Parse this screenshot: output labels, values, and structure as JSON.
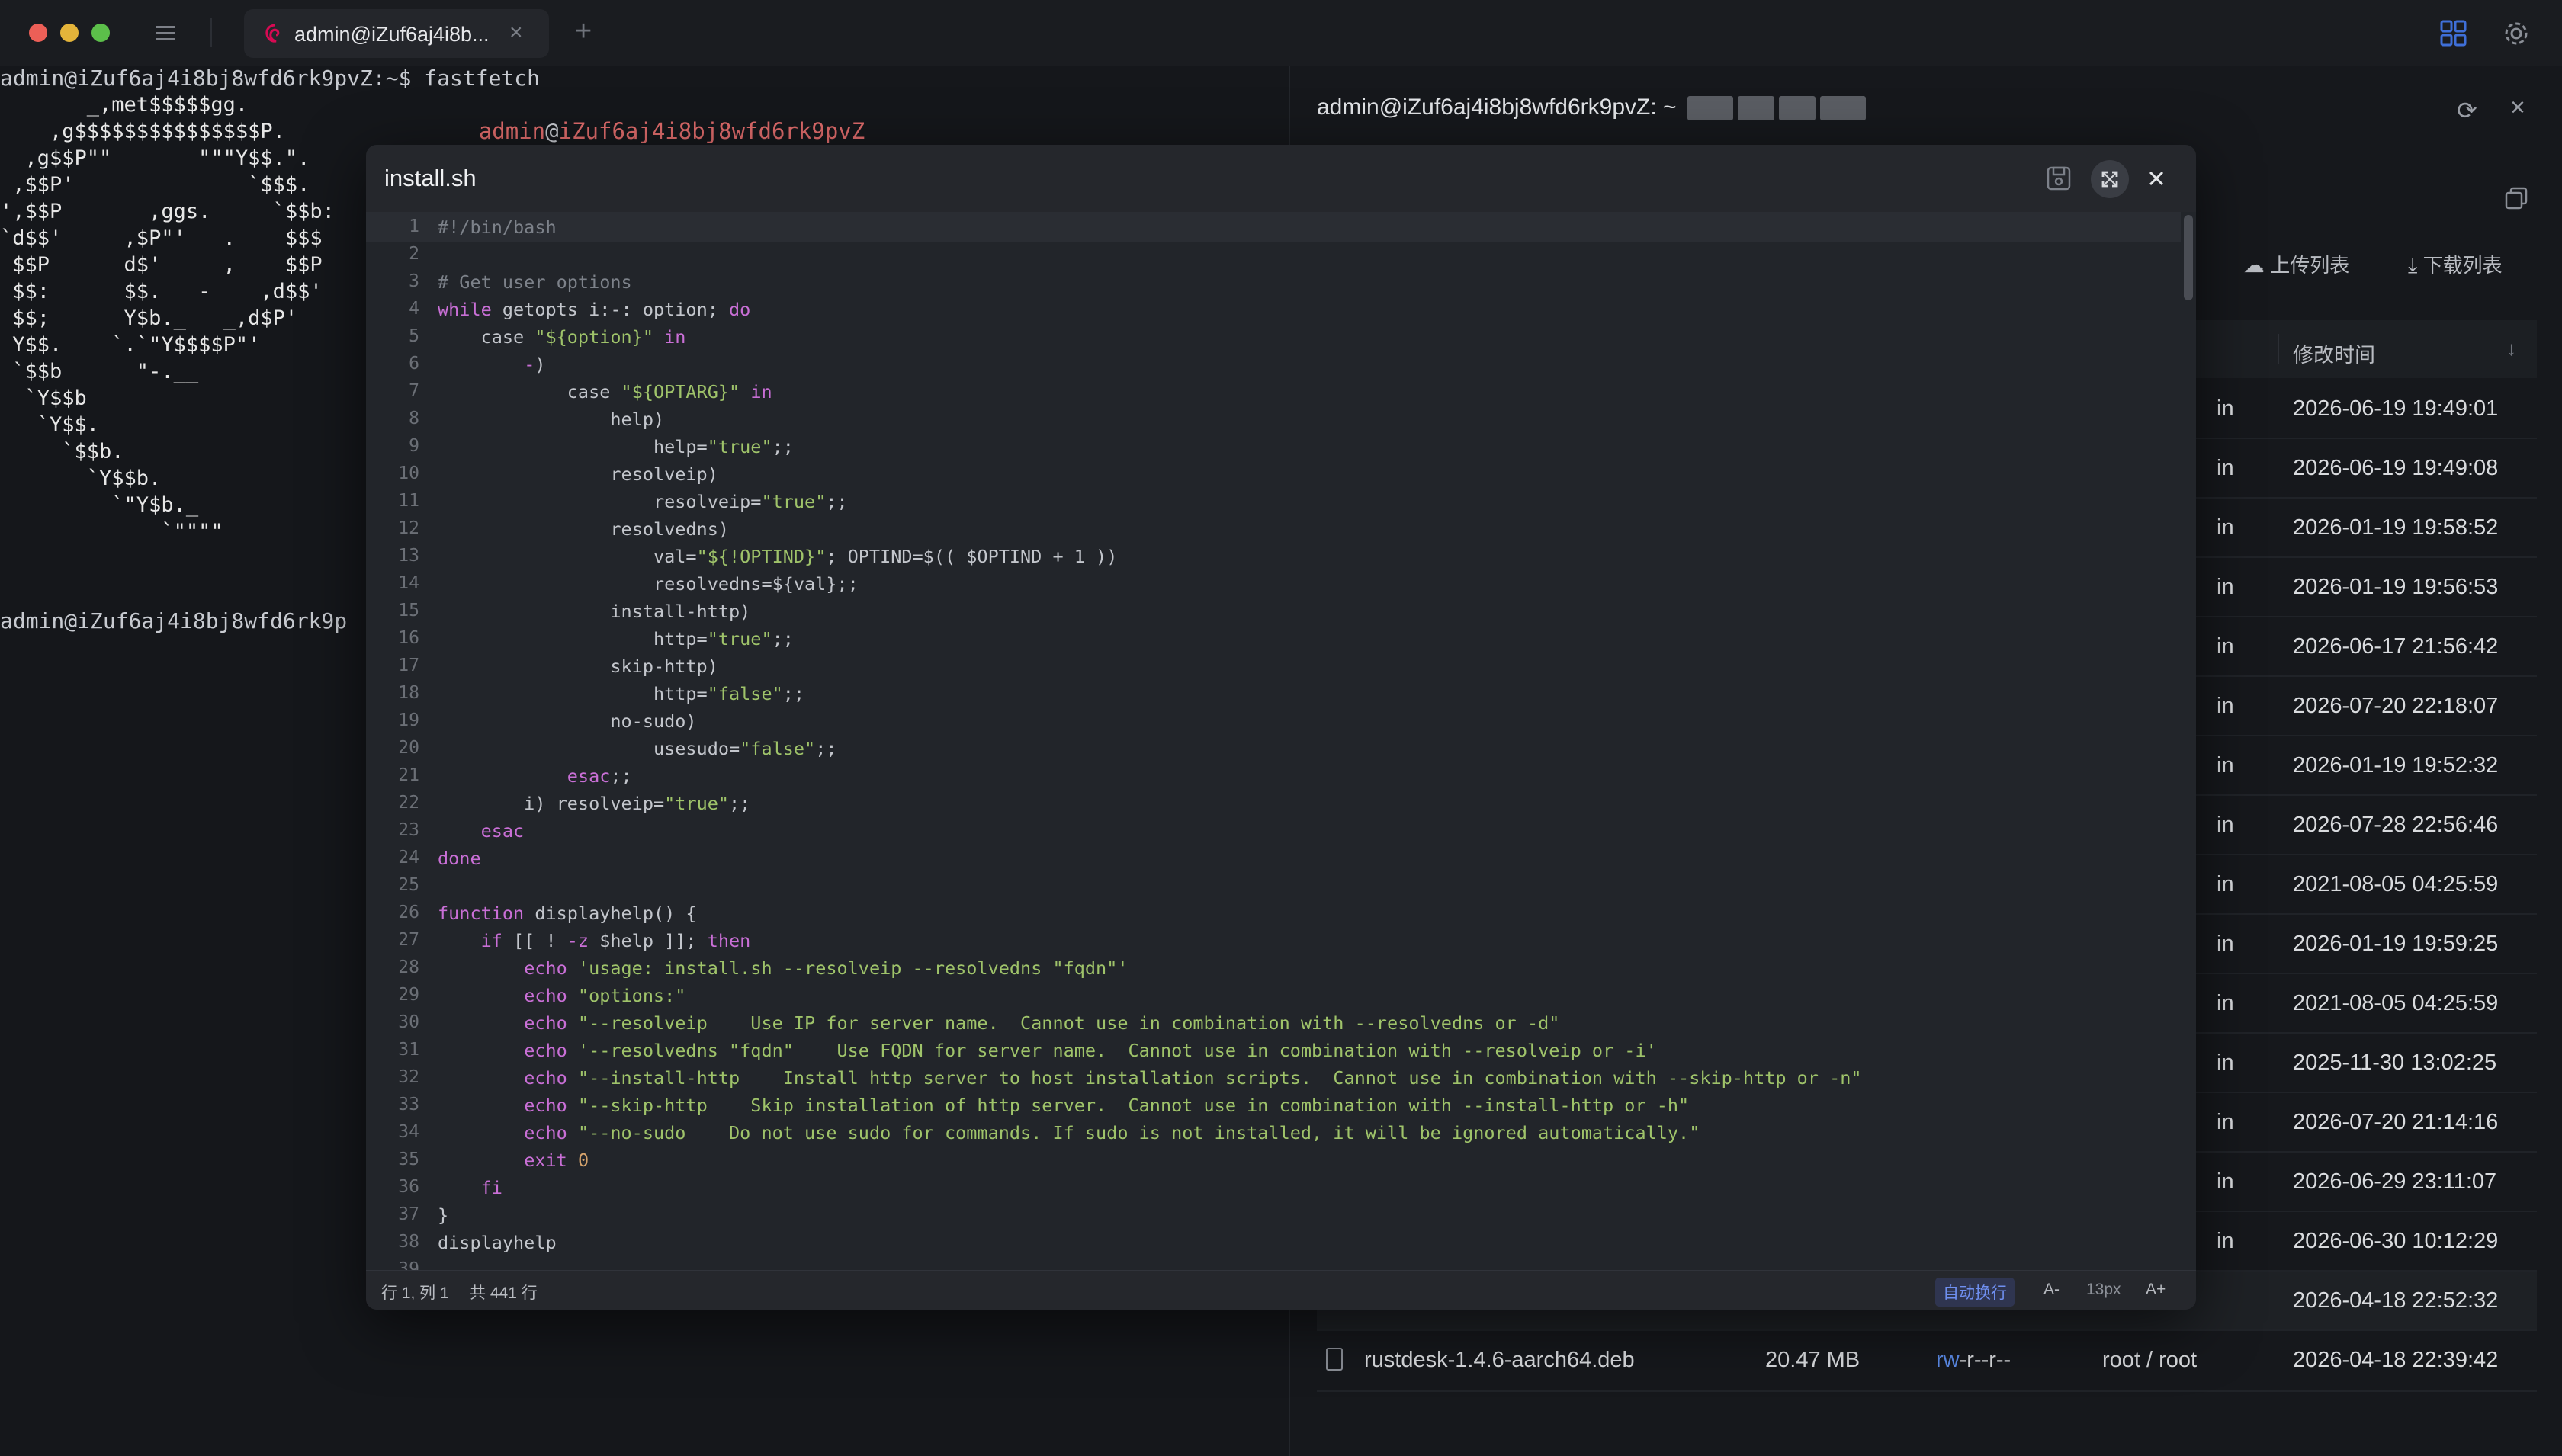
{
  "tab": {
    "title": "admin@iZuf6aj4i8b...",
    "close": "×",
    "add": "+"
  },
  "terminal": {
    "command_line": "admin@iZuf6aj4i8bj8wfd6rk9pvZ:~$ fastfetch",
    "ascii": "       _,met$$$$$gg.\n    ,g$$$$$$$$$$$$$$$P.\n  ,g$$P\"\"       \"\"\"Y$$.\".\n ,$$P'              `$$$.\n',$$P       ,ggs.     `$$b:\n`d$$'     ,$P\"'   .    $$$\n $$P      d$'     ,    $$P\n $$:      $$.   -    ,d$$'\n $$;      Y$b._   _,d$P'\n Y$$.    `.`\"Y$$$$P\"'\n `$$b      \"-.__\n  `Y$$b\n   `Y$$.\n     `$$b.\n       `Y$$b.\n         `\"Y$b._\n             `\"\"\"\"",
    "info_user": "admin",
    "info_at": "@",
    "info_host": "iZuf6aj4i8bj8wfd6rk9pvZ",
    "info_sep": "-----------------------------",
    "prompt_line": "admin@iZuf6aj4i8bj8wfd6rk9p"
  },
  "sftp": {
    "header": "admin@iZuf6aj4i8bj8wfd6rk9pvZ: ~",
    "upload_list": "上传列表",
    "download_list": "下载列表",
    "col_modified": "修改时间",
    "rows": [
      {
        "perm_tail": "in",
        "time": "2026-06-19 19:49:01"
      },
      {
        "perm_tail": "in",
        "time": "2026-06-19 19:49:08"
      },
      {
        "perm_tail": "in",
        "time": "2026-01-19 19:58:52"
      },
      {
        "perm_tail": "in",
        "time": "2026-01-19 19:56:53"
      },
      {
        "perm_tail": "in",
        "time": "2026-06-17 21:56:42"
      },
      {
        "perm_tail": "in",
        "time": "2026-07-20 22:18:07"
      },
      {
        "perm_tail": "in",
        "time": "2026-01-19 19:52:32"
      },
      {
        "perm_tail": "in",
        "time": "2026-07-28 22:56:46"
      },
      {
        "perm_tail": "in",
        "time": "2021-08-05 04:25:59"
      },
      {
        "perm_tail": "in",
        "time": "2026-01-19 19:59:25"
      },
      {
        "perm_tail": "in",
        "time": "2021-08-05 04:25:59"
      },
      {
        "perm_tail": "in",
        "time": "2025-11-30 13:02:25"
      },
      {
        "perm_tail": "in",
        "time": "2026-07-20 21:14:16"
      },
      {
        "perm_tail": "in",
        "time": "2026-06-29 23:11:07"
      },
      {
        "perm_tail": "in",
        "time": "2026-06-30 10:12:29"
      },
      {
        "perm_tail": "",
        "time": "2026-04-18 22:52:32"
      }
    ],
    "last_file": {
      "name": "rustdesk-1.4.6-aarch64.deb",
      "size": "20.47 MB",
      "perm_rw": "rw",
      "perm_rest": "-r--r--",
      "owner": "root / root",
      "time": "2026-04-18 22:39:42"
    }
  },
  "editor": {
    "filename": "install.sh",
    "status_position": "行 1, 列 1",
    "status_total": "共 441 行",
    "wrap_toggle": "自动换行",
    "font_minus": "A-",
    "font_size": "13px",
    "font_plus": "A+",
    "lines": [
      [
        [
          "cm",
          "#!/bin/bash"
        ]
      ],
      [],
      [
        [
          "cm",
          "# Get user options"
        ]
      ],
      [
        [
          "kw",
          "while"
        ],
        [
          "pl",
          " getopts i:-: option; "
        ],
        [
          "kw",
          "do"
        ]
      ],
      [
        [
          "pl",
          "    case "
        ],
        [
          "str",
          "\"${option}\""
        ],
        [
          "pl",
          " "
        ],
        [
          "kw",
          "in"
        ]
      ],
      [
        [
          "pl",
          "        "
        ],
        [
          "kw",
          "-"
        ],
        [
          "pl",
          ")"
        ]
      ],
      [
        [
          "pl",
          "            case "
        ],
        [
          "str",
          "\"${OPTARG}\""
        ],
        [
          "pl",
          " "
        ],
        [
          "kw",
          "in"
        ]
      ],
      [
        [
          "pl",
          "                help)"
        ]
      ],
      [
        [
          "pl",
          "                    help="
        ],
        [
          "str",
          "\"true\""
        ],
        [
          "pl",
          ";;"
        ]
      ],
      [
        [
          "pl",
          "                resolveip)"
        ]
      ],
      [
        [
          "pl",
          "                    resolveip="
        ],
        [
          "str",
          "\"true\""
        ],
        [
          "pl",
          ";;"
        ]
      ],
      [
        [
          "pl",
          "                resolvedns)"
        ]
      ],
      [
        [
          "pl",
          "                    val="
        ],
        [
          "str",
          "\"${!OPTIND}\""
        ],
        [
          "pl",
          "; OPTIND=$(( $OPTIND + 1 ))"
        ]
      ],
      [
        [
          "pl",
          "                    resolvedns=${val};;"
        ]
      ],
      [
        [
          "pl",
          "                install-http)"
        ]
      ],
      [
        [
          "pl",
          "                    http="
        ],
        [
          "str",
          "\"true\""
        ],
        [
          "pl",
          ";;"
        ]
      ],
      [
        [
          "pl",
          "                skip-http)"
        ]
      ],
      [
        [
          "pl",
          "                    http="
        ],
        [
          "str",
          "\"false\""
        ],
        [
          "pl",
          ";;"
        ]
      ],
      [
        [
          "pl",
          "                no-sudo)"
        ]
      ],
      [
        [
          "pl",
          "                    usesudo="
        ],
        [
          "str",
          "\"false\""
        ],
        [
          "pl",
          ";;"
        ]
      ],
      [
        [
          "pl",
          "            "
        ],
        [
          "kw",
          "esac"
        ],
        [
          "pl",
          ";;"
        ]
      ],
      [
        [
          "pl",
          "        i) resolveip="
        ],
        [
          "str",
          "\"true\""
        ],
        [
          "pl",
          ";;"
        ]
      ],
      [
        [
          "pl",
          "    "
        ],
        [
          "kw",
          "esac"
        ]
      ],
      [
        [
          "kw",
          "done"
        ]
      ],
      [],
      [
        [
          "kw",
          "function"
        ],
        [
          "pl",
          " displayhelp() {"
        ]
      ],
      [
        [
          "pl",
          "    "
        ],
        [
          "kw",
          "if"
        ],
        [
          "pl",
          " [[ ! "
        ],
        [
          "kw",
          "-z"
        ],
        [
          "pl",
          " $help ]]; "
        ],
        [
          "kw",
          "then"
        ]
      ],
      [
        [
          "pl",
          "        "
        ],
        [
          "kw",
          "echo"
        ],
        [
          "pl",
          " "
        ],
        [
          "str",
          "'usage: install.sh --resolveip --resolvedns \"fqdn\"'"
        ]
      ],
      [
        [
          "pl",
          "        "
        ],
        [
          "kw",
          "echo"
        ],
        [
          "pl",
          " "
        ],
        [
          "str",
          "\"options:\""
        ]
      ],
      [
        [
          "pl",
          "        "
        ],
        [
          "kw",
          "echo"
        ],
        [
          "pl",
          " "
        ],
        [
          "str",
          "\"--resolveip    Use IP for server name.  Cannot use in combination with --resolvedns or -d\""
        ]
      ],
      [
        [
          "pl",
          "        "
        ],
        [
          "kw",
          "echo"
        ],
        [
          "pl",
          " "
        ],
        [
          "str",
          "'--resolvedns \"fqdn\"    Use FQDN for server name.  Cannot use in combination with --resolveip or -i'"
        ]
      ],
      [
        [
          "pl",
          "        "
        ],
        [
          "kw",
          "echo"
        ],
        [
          "pl",
          " "
        ],
        [
          "str",
          "\"--install-http    Install http server to host installation scripts.  Cannot use in combination with --skip-http or -n\""
        ]
      ],
      [
        [
          "pl",
          "        "
        ],
        [
          "kw",
          "echo"
        ],
        [
          "pl",
          " "
        ],
        [
          "str",
          "\"--skip-http    Skip installation of http server.  Cannot use in combination with --install-http or -h\""
        ]
      ],
      [
        [
          "pl",
          "        "
        ],
        [
          "kw",
          "echo"
        ],
        [
          "pl",
          " "
        ],
        [
          "str",
          "\"--no-sudo    Do not use sudo for commands. If sudo is not installed, it will be ignored automatically.\""
        ]
      ],
      [
        [
          "pl",
          "        "
        ],
        [
          "kw",
          "exit"
        ],
        [
          "pl",
          " "
        ],
        [
          "var",
          "0"
        ]
      ],
      [
        [
          "pl",
          "    "
        ],
        [
          "kw",
          "fi"
        ]
      ],
      [
        [
          "pl",
          "}"
        ]
      ],
      [
        [
          "pl",
          "displayhelp"
        ]
      ]
    ]
  }
}
